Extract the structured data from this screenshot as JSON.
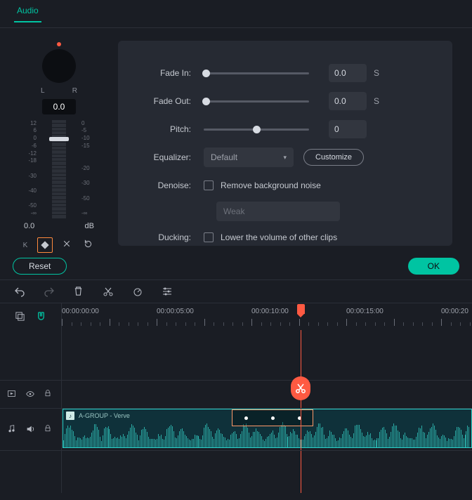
{
  "tabs": {
    "audio": "Audio"
  },
  "pan": {
    "l": "L",
    "r": "R",
    "value": "0.0",
    "db_value": "0.0",
    "db_label": "dB",
    "k_label": "K",
    "scale_left": [
      "12",
      "6",
      "0",
      "-6",
      "-12",
      "-18",
      "",
      "-30",
      "",
      "-40",
      "",
      "-50",
      "-∞"
    ],
    "scale_right": [
      "0",
      "-5",
      "-10",
      "-15",
      "",
      "",
      "-20",
      "",
      "-30",
      "",
      "-50",
      "",
      "-∞"
    ]
  },
  "props": {
    "fadein": {
      "label": "Fade In:",
      "value": "0.0",
      "unit": "S"
    },
    "fadeout": {
      "label": "Fade Out:",
      "value": "0.0",
      "unit": "S"
    },
    "pitch": {
      "label": "Pitch:",
      "value": "0"
    },
    "equalizer": {
      "label": "Equalizer:",
      "selected": "Default",
      "customize": "Customize"
    },
    "denoise": {
      "label": "Denoise:",
      "check_label": "Remove background noise",
      "level": "Weak"
    },
    "ducking": {
      "label": "Ducking:",
      "check_label": "Lower the volume of other clips"
    }
  },
  "actions": {
    "reset": "Reset",
    "ok": "OK"
  },
  "timeline": {
    "ticks": [
      "00:00:00:00",
      "00:00:05:00",
      "00:00:10:00",
      "00:00:15:00",
      "00:00:20"
    ],
    "clip_name": "A-GROUP - Verve"
  }
}
